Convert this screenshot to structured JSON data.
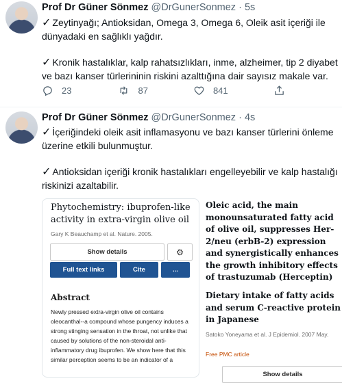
{
  "tweets": [
    {
      "author": "Prof Dr Güner Sönmez",
      "handle": "@DrGunerSonmez",
      "time": "5s",
      "paragraphs": [
        "Zeytinyağı; Antioksidan, Omega 3, Omega 6, Oleik asit içeriği ile dünyadaki en sağlıklı yağdır.",
        "Kronik hastalıklar, kalp rahatsızlıkları, inme, alzheimer, tip 2 diyabet ve bazı kanser türlerininin riskini azalttığına dair sayısız makale var."
      ],
      "check": "✓",
      "replies": "23",
      "retweets": "87",
      "likes": "841"
    },
    {
      "author": "Prof Dr Güner Sönmez",
      "handle": "@DrGunerSonmez",
      "time": "4s",
      "paragraphs": [
        "İçeriğindeki oleik asit inflamasyonu  ve bazı kanser türlerini önleme üzerine etkili bulunmuştur.",
        "Antioksidan içeriği kronik hastalıkları engelleyebilir ve kalp hastalığı riskinizi azaltabilir."
      ],
      "check": "✓"
    }
  ],
  "separator": "·",
  "card": {
    "title": "Phytochemistry: ibuprofen-like activity in extra-virgin olive oil",
    "authors": "Gary K Beauchamp et al. Nature. 2005.",
    "show_details": "Show details",
    "gear": "⚙",
    "full_text": "Full text links",
    "cite": "Cite",
    "more": "...",
    "abstract_heading": "Abstract",
    "abstract_text": "Newly pressed extra-virgin olive oil contains oleocanthal--a compound whose pungency induces a strong stinging sensation in the throat, not unlike that caused by solutions of the non-steroidal anti-inflammatory drug ibuprofen. We show here that this similar perception seems to be an indicator of a"
  },
  "right": {
    "article1_title": "Oleic acid, the main monounsaturated fatty acid of olive oil, suppresses Her-2/neu (erbB-2) expression and synergistically enhances the growth inhibitory effects of trastuzumab (Herceptin) in breast cancer cells with Her",
    "article2_title": "Dietary intake of fatty acids and serum C-reactive protein in Japanese",
    "article2_authors": "Satoko Yoneyama et al. J Epidemiol. 2007 May.",
    "article2_free": "Free PMC article",
    "article2_show_details": "Show details"
  },
  "colors": {
    "text": "#0f1419",
    "secondary": "#536471",
    "pmc_blue": "#205493",
    "free_orange": "#c44b00"
  }
}
